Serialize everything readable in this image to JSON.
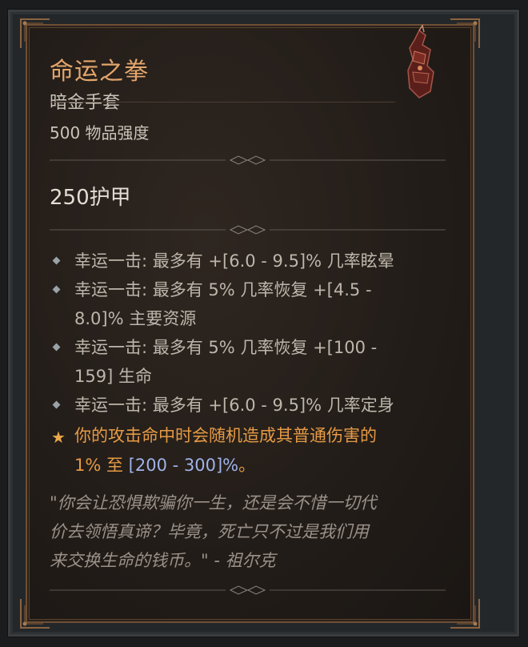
{
  "item": {
    "name": "命运之拳",
    "type": "暗金手套",
    "power": "500 物品强度",
    "armor": "250护甲"
  },
  "affixes": [
    {
      "line1": "幸运一击: 最多有 +[6.0 - 9.5]% 几率眩晕",
      "line2": ""
    },
    {
      "line1": "幸运一击: 最多有 5% 几率恢复 +[4.5 -",
      "line2": "8.0]% 主要资源"
    },
    {
      "line1": "幸运一击: 最多有 5% 几率恢复 +[100 -",
      "line2": "159] 生命"
    },
    {
      "line1": "幸运一击: 最多有 +[6.0 - 9.5]% 几率定身",
      "line2": ""
    }
  ],
  "unique_aspect": {
    "line1": "你的攻击命中时会随机造成其普通伤害的",
    "line2_prefix": "1% 至 ",
    "line2_range": "[200 - 300]%",
    "line2_suffix": "。"
  },
  "flavor_text": {
    "line1": "\"你会让恐惧欺骗你一生，还是会不惜一切代",
    "line2": "价去领悟真谛？毕竟，死亡只不过是我们用",
    "line3": "来交换生命的钱币。\" - 祖尔克"
  },
  "icons": {
    "item": "gauntlet-icon",
    "affix_bullet": "diamond-bullet-icon",
    "aspect_marker": "star-icon"
  },
  "colors": {
    "unique_name": "#e3a66c",
    "aspect_text": "#e59a45",
    "range_text": "#9fb3e8",
    "affix_text": "#bcb6ab",
    "flavor_text": "#9a9189"
  }
}
